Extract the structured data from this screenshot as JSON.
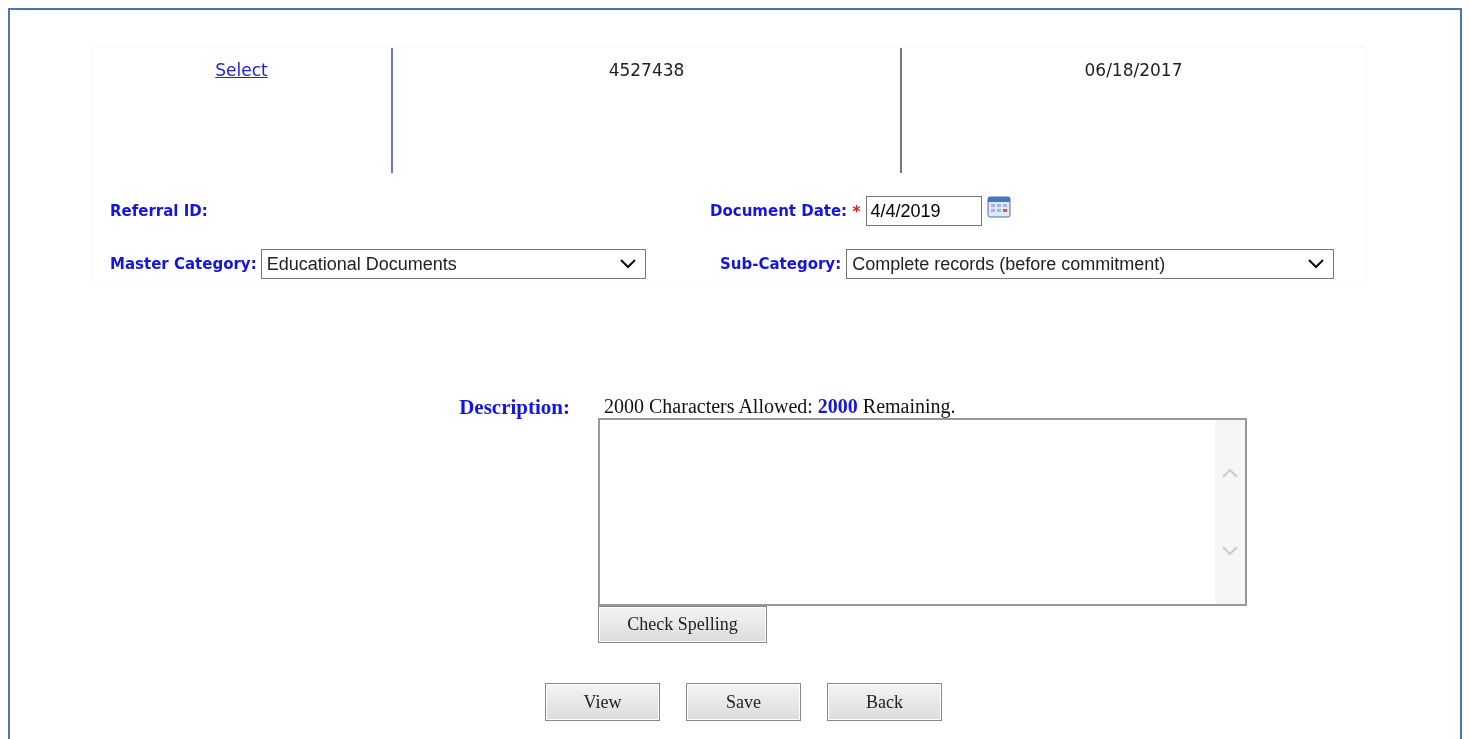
{
  "record_row": {
    "link": "Select",
    "cells": [
      "4527438",
      "06/18/2017"
    ]
  },
  "fields": {
    "referral_id": {
      "label": "Referral ID:"
    },
    "document_date": {
      "label": "Document Date:",
      "required_mark": "*",
      "value": "4/4/2019"
    },
    "master_category": {
      "label": "Master Category:",
      "value": "Educational Documents"
    },
    "sub_category": {
      "label": "Sub-Category:",
      "value": "Complete records (before commitment)"
    }
  },
  "description": {
    "label": "Description:",
    "counter": "2000 Characters Allowed:  **2000** Remaining.",
    "spell_button": "Check Spelling"
  },
  "buttons": [
    "View",
    "Save",
    "Back"
  ]
}
